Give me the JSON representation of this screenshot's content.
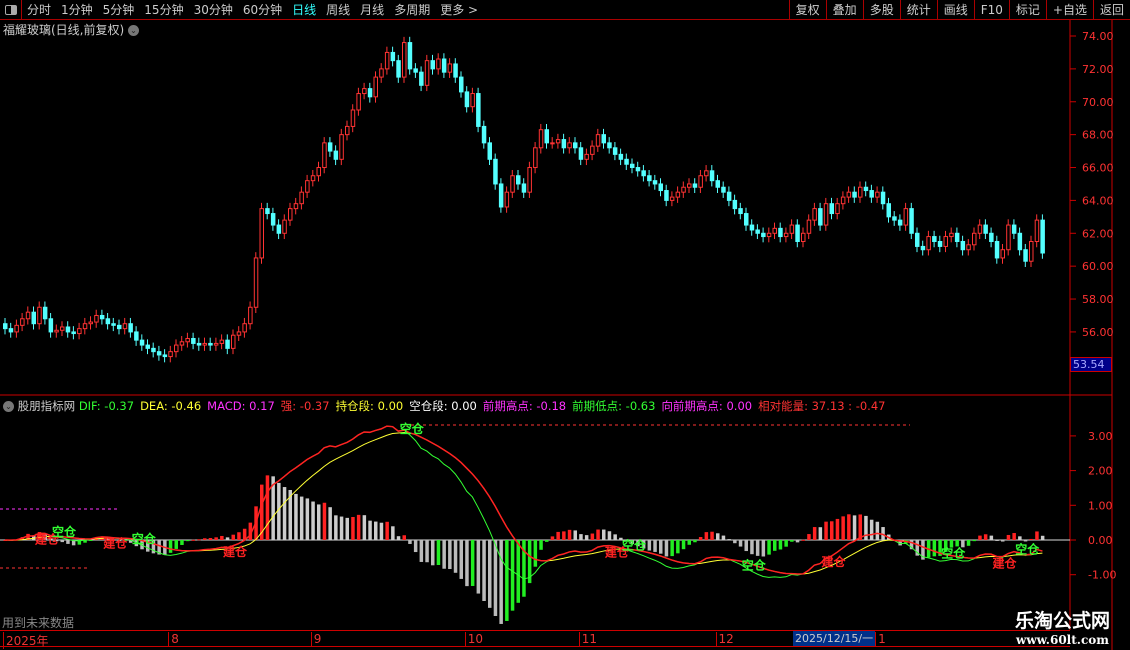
{
  "toolbar": {
    "periods": [
      "分时",
      "1分钟",
      "5分钟",
      "15分钟",
      "30分钟",
      "60分钟",
      "日线",
      "周线",
      "月线",
      "多周期",
      "更多 >"
    ],
    "active": "日线",
    "right_buttons": [
      "复权",
      "叠加",
      "多股",
      "统计",
      "画线",
      "F10",
      "标记",
      "+自选",
      "返回"
    ]
  },
  "chart_title": "福耀玻璃(日线,前复权)",
  "price_axis": {
    "ticks": [
      "74.00",
      "72.00",
      "70.00",
      "68.00",
      "66.00",
      "64.00",
      "62.00",
      "60.00",
      "58.00",
      "56.00"
    ],
    "last_value": "53.54"
  },
  "indicator": {
    "name": "股朋指标网",
    "items": [
      {
        "label": "DIF: -0.37",
        "color": "#33ff33"
      },
      {
        "label": "DEA: -0.46",
        "color": "#ffff33"
      },
      {
        "label": "MACD: 0.17",
        "color": "#ff33ff"
      },
      {
        "label": "强: -0.37",
        "color": "#ff3333"
      },
      {
        "label": "持仓段: 0.00",
        "color": "#ffff33"
      },
      {
        "label": "空仓段: 0.00",
        "color": "#ffffff"
      },
      {
        "label": "前期高点: -0.18",
        "color": "#ff33ff"
      },
      {
        "label": "前期低点: -0.63",
        "color": "#33ff33"
      },
      {
        "label": "向前期高点: 0.00",
        "color": "#ff33ff"
      },
      {
        "label": "相对能量: 37.13 : -0.47",
        "color": "#ff3333"
      }
    ],
    "axis_ticks": [
      "3.00",
      "2.00",
      "1.00",
      "0.00",
      "-1.00"
    ],
    "signals": [
      {
        "i": 7,
        "t": "建仓"
      },
      {
        "i": 10,
        "t": "空仓"
      },
      {
        "i": 19,
        "t": "建仓"
      },
      {
        "i": 24,
        "t": "空仓"
      },
      {
        "i": 40,
        "t": "建仓"
      },
      {
        "i": 71,
        "t": "空仓"
      },
      {
        "i": 107,
        "t": "建仓"
      },
      {
        "i": 110,
        "t": "空仓"
      },
      {
        "i": 131,
        "t": "空仓"
      },
      {
        "i": 145,
        "t": "建仓"
      },
      {
        "i": 166,
        "t": "空仓"
      },
      {
        "i": 175,
        "t": "建仓"
      },
      {
        "i": 179,
        "t": "空仓"
      }
    ]
  },
  "warning": "用到未来数据",
  "time_axis": {
    "labels": [
      {
        "t": "2025年",
        "c": 0
      },
      {
        "t": "8",
        "c": 29
      },
      {
        "t": "9",
        "c": 54
      },
      {
        "t": "10",
        "c": 81
      },
      {
        "t": "11",
        "c": 101
      },
      {
        "t": "12",
        "c": 125
      },
      {
        "t": "1",
        "c": 153
      }
    ],
    "cursor_date": "2025/12/15/一"
  },
  "watermark": {
    "name": "乐淘公式网",
    "url": "www.60lt.com"
  },
  "colors": {
    "up": "#ff3333",
    "down": "#54ffff",
    "axis": "#cc0000"
  },
  "chart_data": {
    "type": "candlestick",
    "ylim": [
      53.5,
      75
    ],
    "open0": 56.5,
    "close": [
      56.2,
      56.0,
      56.4,
      56.8,
      57.2,
      56.5,
      57.5,
      56.8,
      56.0,
      56.1,
      56.3,
      56.0,
      55.9,
      56.2,
      56.5,
      56.6,
      57.0,
      56.8,
      56.5,
      56.4,
      56.2,
      56.5,
      56.0,
      55.5,
      55.2,
      55.0,
      54.8,
      54.6,
      54.5,
      54.8,
      55.2,
      55.4,
      55.6,
      55.3,
      55.2,
      55.3,
      55.2,
      55.3,
      55.5,
      55.0,
      55.8,
      56.0,
      56.5,
      57.5,
      60.5,
      63.5,
      63.2,
      62.5,
      62.0,
      62.8,
      63.5,
      63.8,
      64.5,
      65.2,
      65.5,
      66.0,
      67.5,
      67.0,
      66.5,
      68.0,
      68.5,
      69.5,
      70.5,
      70.8,
      70.3,
      71.5,
      72.0,
      73.0,
      72.5,
      71.5,
      73.6,
      72.0,
      71.8,
      71.0,
      72.5,
      72.0,
      72.6,
      71.8,
      72.3,
      71.5,
      70.6,
      69.7,
      70.5,
      68.5,
      67.5,
      66.5,
      65.0,
      63.6,
      64.5,
      65.5,
      65.0,
      64.5,
      66.0,
      67.2,
      68.3,
      67.5,
      67.5,
      67.7,
      67.2,
      67.5,
      67.2,
      66.5,
      66.8,
      67.3,
      68.0,
      67.5,
      67.2,
      66.8,
      66.5,
      66.2,
      66.0,
      65.8,
      65.5,
      65.2,
      65.0,
      64.6,
      64.0,
      64.2,
      64.5,
      64.8,
      65.0,
      64.8,
      65.5,
      65.8,
      65.2,
      64.8,
      64.5,
      64.0,
      63.5,
      63.2,
      62.5,
      62.2,
      62.0,
      61.8,
      62.0,
      62.3,
      61.8,
      62.0,
      62.5,
      61.5,
      62.0,
      62.8,
      63.5,
      62.5,
      63.8,
      63.2,
      63.8,
      64.2,
      64.5,
      64.2,
      64.8,
      64.6,
      64.2,
      64.5,
      63.8,
      63.0,
      62.8,
      62.5,
      63.5,
      62.0,
      61.2,
      61.0,
      61.8,
      61.5,
      61.2,
      61.8,
      62.0,
      61.5,
      61.0,
      61.3,
      62.0,
      62.5,
      62.0,
      61.5,
      60.5,
      61.0,
      62.5,
      62.0,
      61.0,
      60.3,
      61.5,
      62.8,
      60.8
    ]
  }
}
